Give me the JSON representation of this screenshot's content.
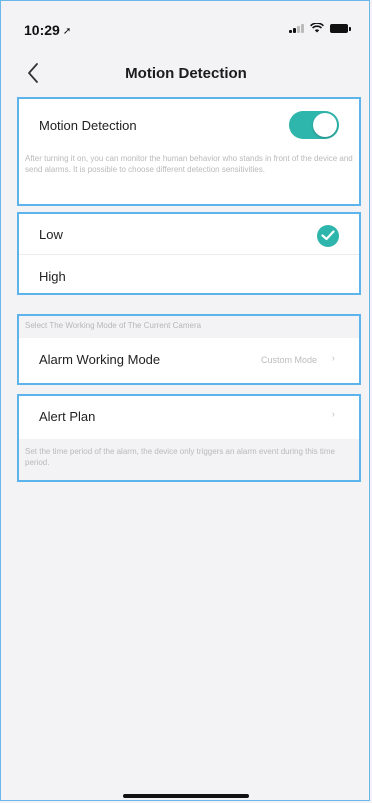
{
  "status_bar": {
    "time": "10:29"
  },
  "nav": {
    "title": "Motion Detection"
  },
  "motion": {
    "label": "Motion Detection",
    "enabled": true,
    "description": "After turning it on, you can monitor the human behavior who stands in front of the device and send alarms. It is possible to choose different detection sensitivities."
  },
  "sensitivity": {
    "options": [
      {
        "label": "Low",
        "selected": true
      },
      {
        "label": "High",
        "selected": false
      }
    ]
  },
  "working_mode": {
    "caption": "Select The Working Mode of The Current Camera",
    "label": "Alarm Working Mode",
    "value": "Custom Mode",
    "chevron": "›"
  },
  "alert_plan": {
    "label": "Alert Plan",
    "chevron": "›",
    "description": "Set the time period of the alarm, the device only triggers an alarm event during this time period."
  },
  "colors": {
    "accent": "#2eb6ad",
    "outline": "#5db3ec"
  }
}
